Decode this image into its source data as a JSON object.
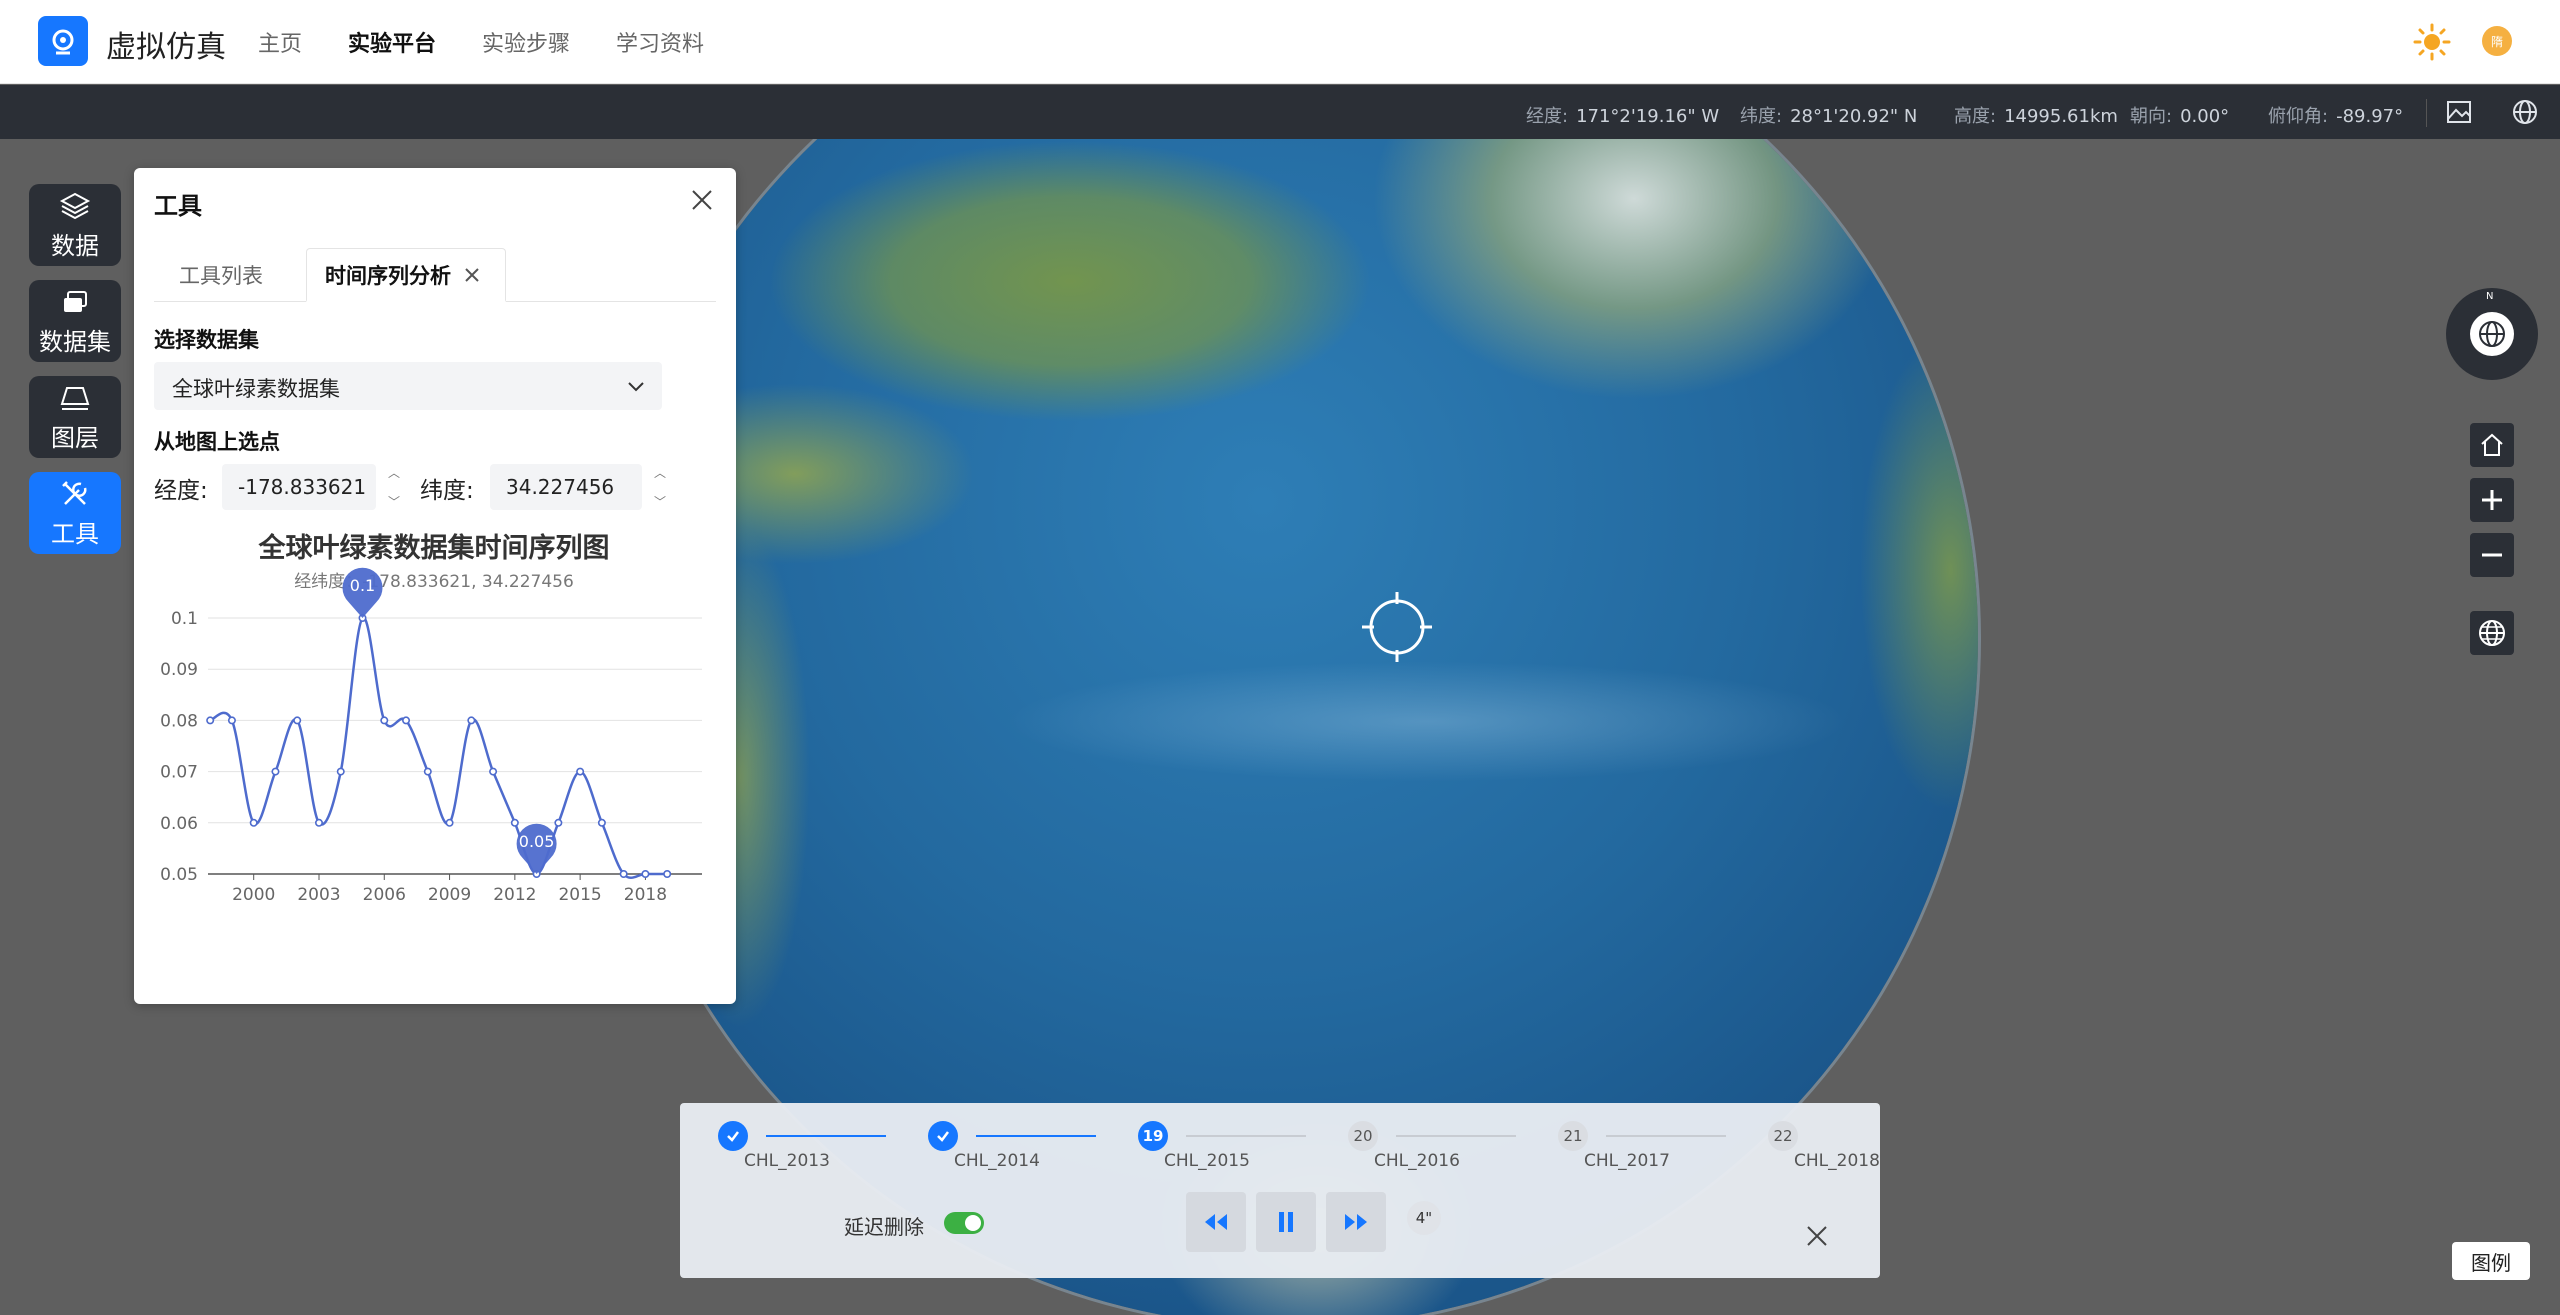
{
  "header": {
    "app_title": "虚拟仿真",
    "nav": [
      "主页",
      "实验平台",
      "实验步骤",
      "学习资料"
    ],
    "active_nav": "实验平台",
    "avatar_text": "隋"
  },
  "status": {
    "lon_label": "经度:",
    "lon": "171°2'19.16\" W",
    "lat_label": "纬度:",
    "lat": "28°1'20.92\" N",
    "alt_label": "高度:",
    "alt": "14995.61km",
    "heading_label": "朝向:",
    "heading": "0.00°",
    "pitch_label": "俯仰角:",
    "pitch": "-89.97°"
  },
  "dock": {
    "data": "数据",
    "dataset": "数据集",
    "layer": "图层",
    "tools": "工具"
  },
  "panel": {
    "title": "工具",
    "tabs": [
      "工具列表",
      "时间序列分析"
    ],
    "select_dataset_label": "选择数据集",
    "dataset_value": "全球叶绿素数据集",
    "pick_label": "从地图上选点",
    "lon_label": "经度:",
    "lon_value": "-178.833621",
    "lat_label": "纬度:",
    "lat_value": "34.227456"
  },
  "chart_data": {
    "type": "line",
    "title": "全球叶绿素数据集时间序列图",
    "subtitle": "经纬度：-178.833621, 34.227456",
    "x": [
      1998,
      1999,
      2000,
      2001,
      2002,
      2003,
      2004,
      2005,
      2006,
      2007,
      2008,
      2009,
      2010,
      2011,
      2012,
      2013,
      2014,
      2015,
      2016,
      2017,
      2018,
      2019
    ],
    "values": [
      0.08,
      0.08,
      0.06,
      0.07,
      0.08,
      0.06,
      0.07,
      0.1,
      0.08,
      0.08,
      0.07,
      0.06,
      0.08,
      0.07,
      0.06,
      0.05,
      0.06,
      0.07,
      0.06,
      0.05,
      0.05,
      0.05
    ],
    "xticks": [
      2000,
      2003,
      2006,
      2009,
      2012,
      2015,
      2018
    ],
    "yticks": [
      0.05,
      0.06,
      0.07,
      0.08,
      0.09,
      0.1
    ],
    "ylim": [
      0.05,
      0.1
    ],
    "xlim": [
      1997.9,
      2020.6
    ],
    "max_label": "0.1",
    "min_label": "0.05",
    "line_color": "#4e6bcd"
  },
  "timeline": {
    "steps": [
      {
        "label": "CHL_2013",
        "state": "done",
        "num": ""
      },
      {
        "label": "CHL_2014",
        "state": "done",
        "num": ""
      },
      {
        "label": "CHL_2015",
        "state": "current",
        "num": "19"
      },
      {
        "label": "CHL_2016",
        "state": "todo",
        "num": "20"
      },
      {
        "label": "CHL_2017",
        "state": "todo",
        "num": "21"
      },
      {
        "label": "CHL_2018",
        "state": "todo",
        "num": "22"
      }
    ],
    "delay_delete_label": "延迟删除",
    "delay_delete_on": true,
    "speed": "4\"",
    "accent": "#1677ff"
  },
  "legend_button": "图例"
}
